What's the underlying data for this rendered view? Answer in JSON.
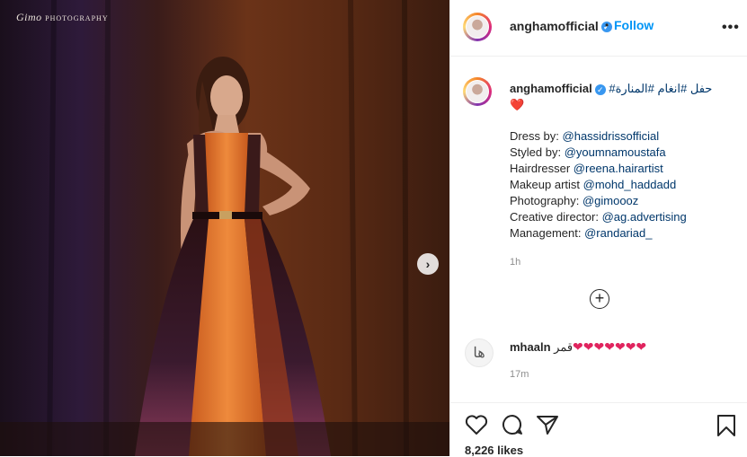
{
  "photo": {
    "watermark_main": "Gimo",
    "watermark_sub": "PHOTOGRAPHY"
  },
  "header": {
    "username": "anghamofficial",
    "separator": "•",
    "follow_label": "Follow",
    "more_label": "•••"
  },
  "caption": {
    "username": "anghamofficial",
    "hashtags": "حفل #انغام #المنارة#",
    "emoji": "❤️",
    "lines": [
      {
        "label": "Dress by: ",
        "mention": "@hassidrissofficial"
      },
      {
        "label": "Styled by: ",
        "mention": "@youmnamoustafa"
      },
      {
        "label": "Hairdresser ",
        "mention": "@reena.hairartist"
      },
      {
        "label": "Makeup artist ",
        "mention": "@mohd_haddadd"
      },
      {
        "label": "Photography: ",
        "mention": "@gimoooz"
      },
      {
        "label": "Creative director: ",
        "mention": "@ag.advertising"
      },
      {
        "label": "Management: ",
        "mention": "@randariad_"
      }
    ],
    "time": "1h"
  },
  "load_more": "+",
  "comment": {
    "username": "mhaaln",
    "text": "قمر",
    "hearts": "❤❤❤❤❤❤❤",
    "time": "17m",
    "avatar_glyph": "ها"
  },
  "footer": {
    "likes": "8,226 likes"
  },
  "colors": {
    "link": "#00376b",
    "follow": "#0095f6",
    "heart": "#e0245e",
    "dress_orange": "#e0732c"
  }
}
